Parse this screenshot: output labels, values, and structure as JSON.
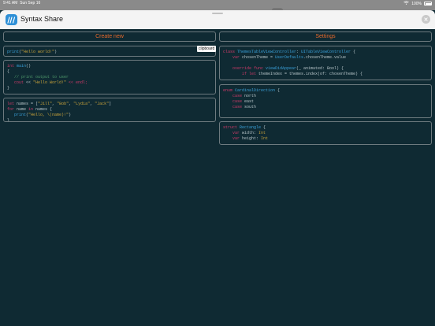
{
  "status_bar": {
    "time": "9:41 AM",
    "date": "Sun Sep 16",
    "battery": "100%"
  },
  "header": {
    "title": "Syntax Share",
    "logo_icon": "app-logo-icon",
    "close_icon": "close-icon"
  },
  "buttons": {
    "create_new": "Create new",
    "settings": "Settings"
  },
  "tooltip": "clipboard",
  "colors": {
    "keyword": "#cc3a68",
    "string": "#c8a23a",
    "comment": "#4f9a6b",
    "type": "#3aa0d8",
    "plain": "#b5c3c7",
    "accent": "#e6692c",
    "background": "#0f2a33"
  },
  "snippets_left": [
    {
      "lines": [
        [
          [
            "print",
            "fn"
          ],
          [
            "(",
            "pl"
          ],
          [
            "\"Hello world!\"",
            "str"
          ],
          [
            ")",
            "pl"
          ]
        ]
      ]
    },
    {
      "lines": [
        [
          [
            "int",
            "kw"
          ],
          [
            " main",
            "fn"
          ],
          [
            "()",
            "pl"
          ]
        ],
        [
          [
            "{",
            "pl"
          ]
        ],
        [
          [
            "   // print output to user",
            "cm"
          ]
        ],
        [
          [
            "   cout",
            "kw"
          ],
          [
            " << ",
            "pl"
          ],
          [
            "\"Hello World!\"",
            "str"
          ],
          [
            " << endl;",
            "kw"
          ]
        ],
        [
          [
            "}",
            "pl"
          ]
        ]
      ]
    },
    {
      "lines": [
        [
          [
            "let",
            "kw"
          ],
          [
            " names = [",
            "pl"
          ],
          [
            "\"Jill\"",
            "str"
          ],
          [
            ", ",
            "pl"
          ],
          [
            "\"Bob\"",
            "str"
          ],
          [
            ", ",
            "pl"
          ],
          [
            "\"Lydia\"",
            "str"
          ],
          [
            ", ",
            "pl"
          ],
          [
            "\"Jack\"",
            "str"
          ],
          [
            "]",
            "pl"
          ]
        ],
        [
          [
            "for",
            "kw"
          ],
          [
            " name ",
            "pl"
          ],
          [
            "in",
            "kw"
          ],
          [
            " names {",
            "pl"
          ]
        ],
        [
          [
            "   print",
            "fn"
          ],
          [
            "(",
            "pl"
          ],
          [
            "\"Hello, \\(name)!\"",
            "str"
          ],
          [
            ")",
            "pl"
          ]
        ],
        [
          [
            "}",
            "pl"
          ]
        ]
      ]
    }
  ],
  "snippets_right": [
    {
      "lines": [
        [
          [
            "class",
            "kw"
          ],
          [
            " ThemesTableViewController",
            "ty"
          ],
          [
            ": ",
            "pl"
          ],
          [
            "UITableViewController",
            "ty"
          ],
          [
            " {",
            "pl"
          ]
        ],
        [
          [
            "    var",
            "kw"
          ],
          [
            " chosenTheme = ",
            "pl"
          ],
          [
            "UserDefaults",
            "ty"
          ],
          [
            ".chosenTheme.value",
            "pl"
          ]
        ],
        [
          [
            "",
            "pl"
          ]
        ],
        [
          [
            "    override",
            "kw"
          ],
          [
            " func",
            "kw"
          ],
          [
            " viewDidAppear",
            "fn"
          ],
          [
            "(_ animated: Bool) {",
            "pl"
          ]
        ],
        [
          [
            "        if",
            "kw"
          ],
          [
            " let",
            "kw"
          ],
          [
            " themeIndex = themes.index(of: chosenTheme) {",
            "pl"
          ]
        ]
      ]
    },
    {
      "lines": [
        [
          [
            "enum",
            "kw"
          ],
          [
            " CardinalDirection",
            "ty"
          ],
          [
            " {",
            "pl"
          ]
        ],
        [
          [
            "    case",
            "kw"
          ],
          [
            " north",
            "pl"
          ]
        ],
        [
          [
            "    case",
            "kw"
          ],
          [
            " east",
            "pl"
          ]
        ],
        [
          [
            "    case",
            "kw"
          ],
          [
            " south",
            "pl"
          ]
        ]
      ]
    },
    {
      "lines": [
        [
          [
            "struct",
            "kw"
          ],
          [
            " Rectangle",
            "ty"
          ],
          [
            " {",
            "pl"
          ]
        ],
        [
          [
            "    var",
            "kw"
          ],
          [
            " width: ",
            "pl"
          ],
          [
            "Int",
            "str"
          ]
        ],
        [
          [
            "    var",
            "kw"
          ],
          [
            " height: ",
            "pl"
          ],
          [
            "Int",
            "str"
          ]
        ]
      ]
    }
  ]
}
